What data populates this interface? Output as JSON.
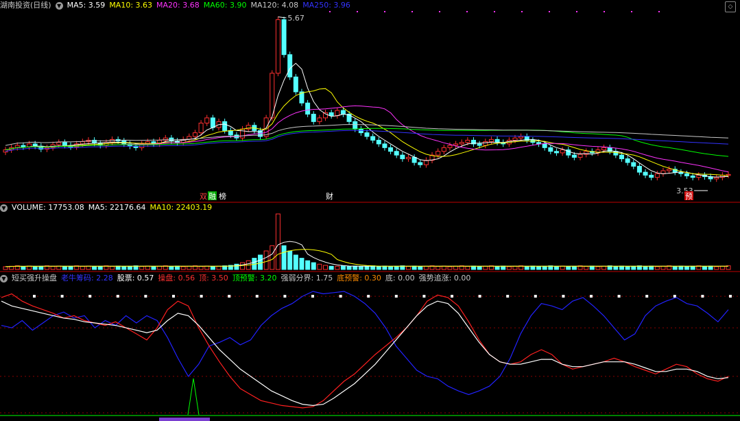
{
  "price_panel": {
    "header": {
      "title": "湖南投资(日线)",
      "items": [
        {
          "label": "MA5: 3.59",
          "color": "#ffffff"
        },
        {
          "label": "MA10: 3.63",
          "color": "#ffff00"
        },
        {
          "label": "MA20: 3.68",
          "color": "#ff33ff"
        },
        {
          "label": "MA60: 3.90",
          "color": "#00ff00"
        },
        {
          "label": "MA120: 4.08",
          "color": "#c8c8c8"
        },
        {
          "label": "MA250: 3.96",
          "color": "#3333ff"
        }
      ]
    },
    "high_label": "5.67",
    "low_label": "3.53",
    "event_tags": [
      {
        "text": "双",
        "color": "#ff4040",
        "bg": "#000000"
      },
      {
        "text": "融",
        "color": "#ffffff",
        "bg": "#00aa00"
      },
      {
        "text": "榜",
        "color": "#ffffff",
        "bg": "#000000"
      },
      {
        "text": "财",
        "color": "#ffffff",
        "bg": "#000000"
      },
      {
        "text": "预",
        "color": "#ffffff",
        "bg": "#cc0000"
      }
    ]
  },
  "volume_panel": {
    "header": [
      {
        "label": "VOLUME: 17753.08",
        "color": "#ffffff"
      },
      {
        "label": "MA5: 22176.64",
        "color": "#ffffff"
      },
      {
        "label": "MA10: 22403.19",
        "color": "#ffff00"
      }
    ]
  },
  "indicator_panel": {
    "header": [
      {
        "label": "短买强升操盘",
        "color": "#c8c8c8"
      },
      {
        "label": "老牛筹码: 2.28",
        "color": "#3333ff"
      },
      {
        "label": "股票: 0.57",
        "color": "#ffffff"
      },
      {
        "label": "操盘: 0.56",
        "color": "#ff3030"
      },
      {
        "label": "顶: 3.50",
        "color": "#ff3030"
      },
      {
        "label": "顶预警: 3.20",
        "color": "#00ff00"
      },
      {
        "label": "强弱分界: 1.75",
        "color": "#c8c8c8"
      },
      {
        "label": "底预警: 0.30",
        "color": "#ff8c00"
      },
      {
        "label": "底: 0.00",
        "color": "#c8c8c8"
      },
      {
        "label": "强势追涨: 0.00",
        "color": "#c8c8c8"
      }
    ]
  },
  "colors": {
    "up": "#ff3030",
    "down": "#54ffff",
    "ma5": "#ffffff",
    "ma10": "#ffff00",
    "ma20": "#ff33ff",
    "ma60": "#00ff00",
    "ma120": "#c8c8c8",
    "ma250": "#3333ff",
    "grid": "#8b0000",
    "blue_line": "#2222ff",
    "red_line": "#ff2020",
    "white_line": "#ffffff"
  },
  "chart_data": {
    "type": "candlestick",
    "price_close_series": [
      3.92,
      3.95,
      3.98,
      3.96,
      4.0,
      3.97,
      3.93,
      3.95,
      3.99,
      4.02,
      3.98,
      3.96,
      4.0,
      4.03,
      4.05,
      4.01,
      3.98,
      4.02,
      4.06,
      4.04,
      4.0,
      3.97,
      3.95,
      4.0,
      4.03,
      4.0,
      4.05,
      4.08,
      4.04,
      4.02,
      4.06,
      4.1,
      4.15,
      4.28,
      4.35,
      4.22,
      4.3,
      4.18,
      4.12,
      4.08,
      4.2,
      4.25,
      4.18,
      4.1,
      4.35,
      4.95,
      5.67,
      5.2,
      4.9,
      4.7,
      4.55,
      4.4,
      4.3,
      4.35,
      4.42,
      4.38,
      4.45,
      4.4,
      4.3,
      4.2,
      4.15,
      4.1,
      4.05,
      4.0,
      3.95,
      3.9,
      3.85,
      3.8,
      3.82,
      3.75,
      3.72,
      3.78,
      3.85,
      3.9,
      3.95,
      3.98,
      4.0,
      4.02,
      4.05,
      4.0,
      3.98,
      4.03,
      4.06,
      4.02,
      4.0,
      4.05,
      4.08,
      4.1,
      4.05,
      4.02,
      4.0,
      3.95,
      3.9,
      3.88,
      3.92,
      3.85,
      3.82,
      3.86,
      3.9,
      3.88,
      3.92,
      3.95,
      3.9,
      3.85,
      3.8,
      3.75,
      3.7,
      3.62,
      3.58,
      3.55,
      3.6,
      3.64,
      3.66,
      3.62,
      3.6,
      3.57,
      3.55,
      3.58,
      3.56,
      3.53,
      3.55,
      3.58,
      3.59
    ],
    "volume_peak_index": 46,
    "indicator_series": {
      "blue": [
        0.72,
        0.7,
        0.76,
        0.68,
        0.74,
        0.8,
        0.83,
        0.78,
        0.8,
        0.7,
        0.76,
        0.72,
        0.8,
        0.74,
        0.8,
        0.76,
        0.62,
        0.45,
        0.3,
        0.4,
        0.55,
        0.58,
        0.62,
        0.56,
        0.6,
        0.72,
        0.8,
        0.86,
        0.9,
        0.96,
        1.0,
        0.98,
        0.99,
        1.0,
        0.96,
        0.9,
        0.82,
        0.7,
        0.55,
        0.45,
        0.35,
        0.3,
        0.28,
        0.22,
        0.18,
        0.15,
        0.18,
        0.22,
        0.3,
        0.45,
        0.65,
        0.8,
        0.9,
        0.88,
        0.85,
        0.92,
        0.95,
        0.88,
        0.8,
        0.7,
        0.6,
        0.65,
        0.8,
        0.88,
        0.92,
        0.95,
        0.9,
        0.88,
        0.82,
        0.75,
        0.85
      ],
      "red": [
        0.95,
        0.98,
        0.92,
        0.88,
        0.85,
        0.82,
        0.78,
        0.8,
        0.76,
        0.74,
        0.72,
        0.75,
        0.7,
        0.65,
        0.6,
        0.7,
        0.85,
        0.92,
        0.88,
        0.7,
        0.55,
        0.42,
        0.3,
        0.2,
        0.15,
        0.1,
        0.08,
        0.06,
        0.05,
        0.04,
        0.05,
        0.1,
        0.18,
        0.26,
        0.32,
        0.4,
        0.48,
        0.55,
        0.62,
        0.7,
        0.8,
        0.92,
        0.97,
        0.95,
        0.88,
        0.75,
        0.6,
        0.48,
        0.42,
        0.4,
        0.42,
        0.48,
        0.52,
        0.48,
        0.4,
        0.36,
        0.38,
        0.4,
        0.42,
        0.45,
        0.42,
        0.38,
        0.35,
        0.32,
        0.36,
        0.4,
        0.38,
        0.32,
        0.28,
        0.26,
        0.3
      ],
      "white": [
        0.92,
        0.88,
        0.86,
        0.84,
        0.82,
        0.8,
        0.78,
        0.77,
        0.75,
        0.74,
        0.73,
        0.72,
        0.7,
        0.68,
        0.66,
        0.68,
        0.76,
        0.82,
        0.8,
        0.72,
        0.62,
        0.52,
        0.44,
        0.36,
        0.3,
        0.24,
        0.18,
        0.14,
        0.1,
        0.07,
        0.06,
        0.07,
        0.12,
        0.18,
        0.24,
        0.32,
        0.4,
        0.5,
        0.6,
        0.7,
        0.8,
        0.88,
        0.92,
        0.9,
        0.82,
        0.7,
        0.58,
        0.48,
        0.42,
        0.4,
        0.4,
        0.42,
        0.44,
        0.44,
        0.4,
        0.38,
        0.38,
        0.4,
        0.42,
        0.42,
        0.42,
        0.4,
        0.37,
        0.34,
        0.34,
        0.36,
        0.36,
        0.34,
        0.3,
        0.28,
        0.29
      ]
    }
  }
}
